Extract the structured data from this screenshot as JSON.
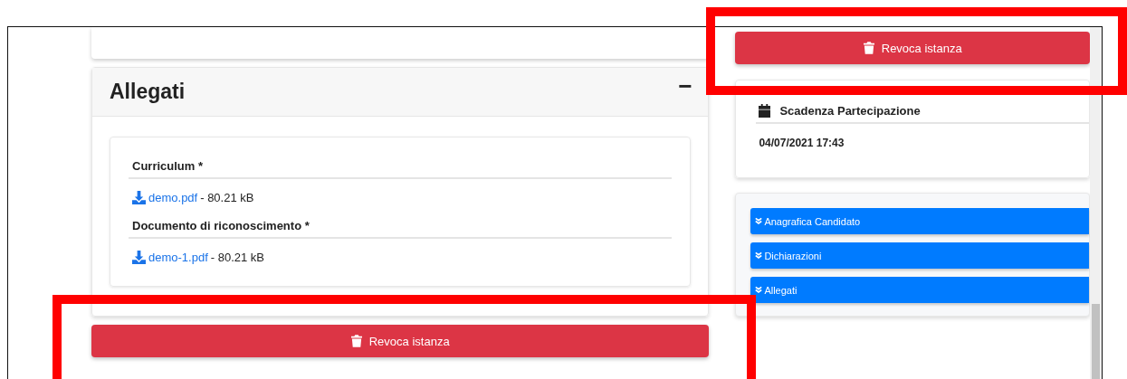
{
  "attachments_panel": {
    "title": "Allegati",
    "collapse_icon": "−",
    "files": [
      {
        "label": "Curriculum *",
        "file_name": "demo.pdf",
        "size": "- 80.21 kB"
      },
      {
        "label": "Documento di riconoscimento *",
        "file_name": "demo-1.pdf",
        "size": "- 80.21 kB"
      }
    ]
  },
  "revoke_button_main": {
    "label": "Revoca istanza"
  },
  "sidebar": {
    "revoke_button": {
      "label": "Revoca istanza"
    },
    "deadline": {
      "title": "Scadenza Partecipazione",
      "value": "04/07/2021 17:43"
    },
    "sections": [
      {
        "label": "Anagrafica Candidato"
      },
      {
        "label": "Dichiarazioni"
      },
      {
        "label": "Allegati"
      }
    ]
  }
}
